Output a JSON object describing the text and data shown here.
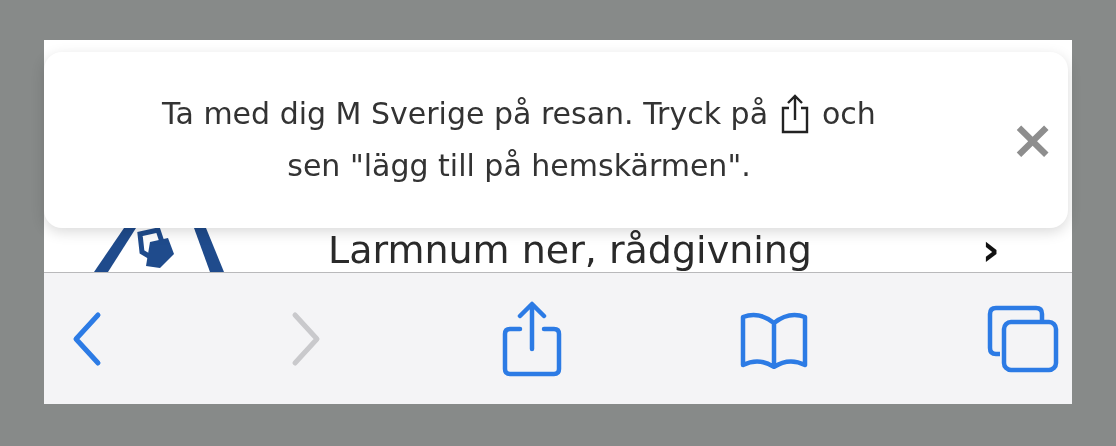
{
  "banner": {
    "text_before": "Ta med dig M Sverige på resan. Tryck på",
    "text_after_icon": "och",
    "line_2": "sen \"lägg till på hemskärmen\".",
    "close": "×"
  },
  "menu_row": {
    "label": "Larmnum ner, rådgivning",
    "chevron": "›"
  },
  "toolbar": [
    {
      "kind": "back",
      "disabled": false
    },
    {
      "kind": "forward",
      "disabled": true
    },
    {
      "kind": "share",
      "disabled": false
    },
    {
      "kind": "bookmarks",
      "disabled": false
    },
    {
      "kind": "tabs",
      "disabled": false
    }
  ]
}
